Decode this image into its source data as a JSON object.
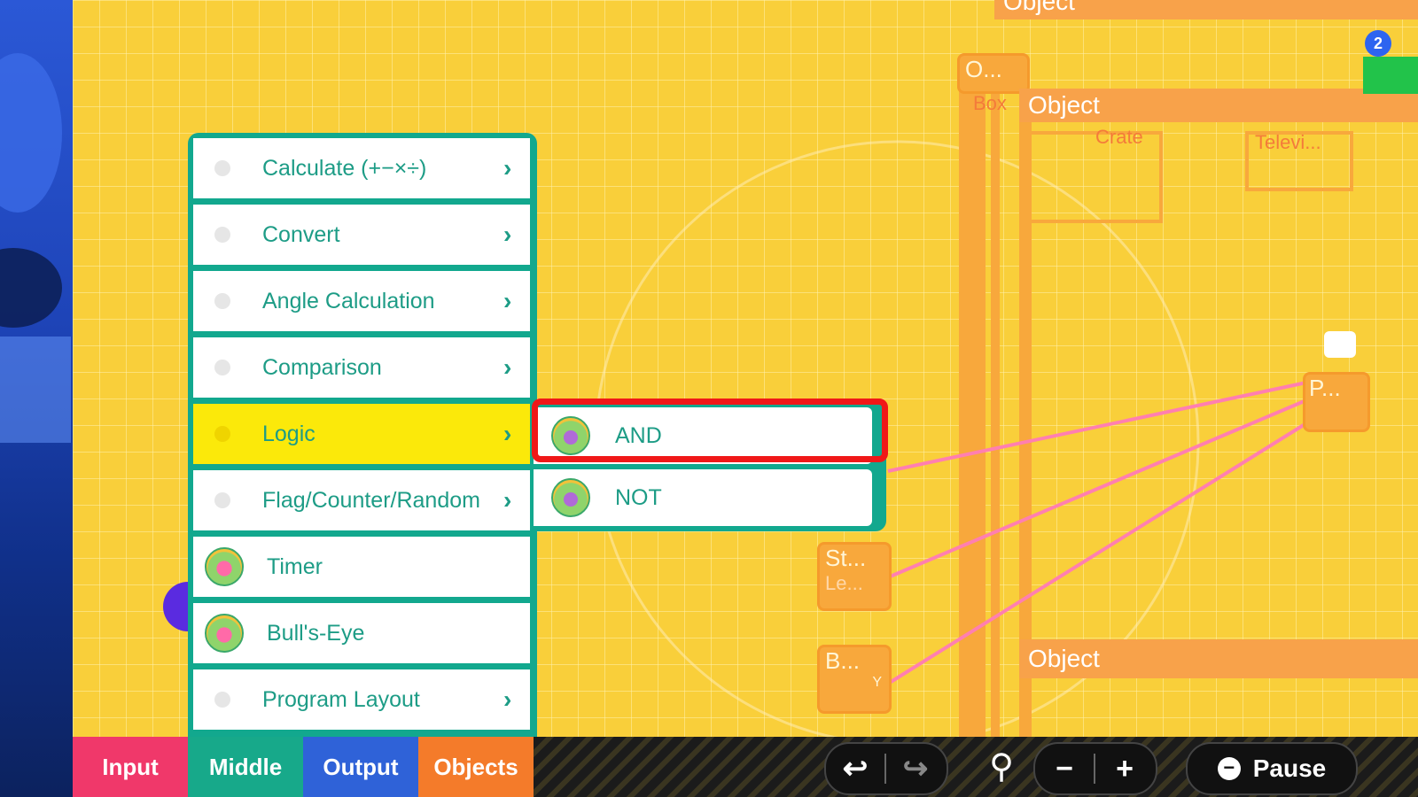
{
  "menu": {
    "items": [
      {
        "label": "Calculate (+−×÷)",
        "has_submenu": true,
        "icon": "dot"
      },
      {
        "label": "Convert",
        "has_submenu": true,
        "icon": "dot"
      },
      {
        "label": "Angle Calculation",
        "has_submenu": true,
        "icon": "dot"
      },
      {
        "label": "Comparison",
        "has_submenu": true,
        "icon": "dot"
      },
      {
        "label": "Logic",
        "has_submenu": true,
        "icon": "dot",
        "selected": true
      },
      {
        "label": "Flag/Counter/Random",
        "has_submenu": true,
        "icon": "dot"
      },
      {
        "label": "Timer",
        "has_submenu": false,
        "icon": "timer-nodon-icon"
      },
      {
        "label": "Bull's-Eye",
        "has_submenu": false,
        "icon": "bullseye-nodon-icon"
      },
      {
        "label": "Program Layout",
        "has_submenu": true,
        "icon": "dot"
      }
    ],
    "chevron": "›"
  },
  "submenu": {
    "items": [
      {
        "label": "AND",
        "icon": "and-nodon-icon",
        "highlighted": true
      },
      {
        "label": "NOT",
        "icon": "not-nodon-icon"
      }
    ]
  },
  "canvas": {
    "object_top": "Object",
    "object_mid": "Object",
    "object_bottom": "Object",
    "box_label": "O...",
    "box_sub": "Box",
    "crate": "Crate",
    "television": "Televi...",
    "player_node": "P...",
    "stick_node": "St...",
    "stick_sub": "Le...",
    "button_node": "B...",
    "button_sub": "Y",
    "badge": "2"
  },
  "bottom_bar": {
    "tabs": [
      {
        "label": "Input",
        "color": "#f0386a"
      },
      {
        "label": "Middle",
        "color": "#17a98a"
      },
      {
        "label": "Output",
        "color": "#2f62d8"
      },
      {
        "label": "Objects",
        "color": "#f47b2a"
      }
    ],
    "undo": "↩",
    "redo": "↪",
    "zoom": "⚲",
    "zoom_out": "−",
    "zoom_in": "+",
    "pause_icon": "−",
    "pause": "Pause"
  },
  "colors": {
    "canvas": "#f9cf3a",
    "menu_border": "#12a88e",
    "menu_text": "#1d9c86",
    "selected": "#fbe90a",
    "highlight": "#f01818",
    "wire": "#ff7fb0"
  }
}
